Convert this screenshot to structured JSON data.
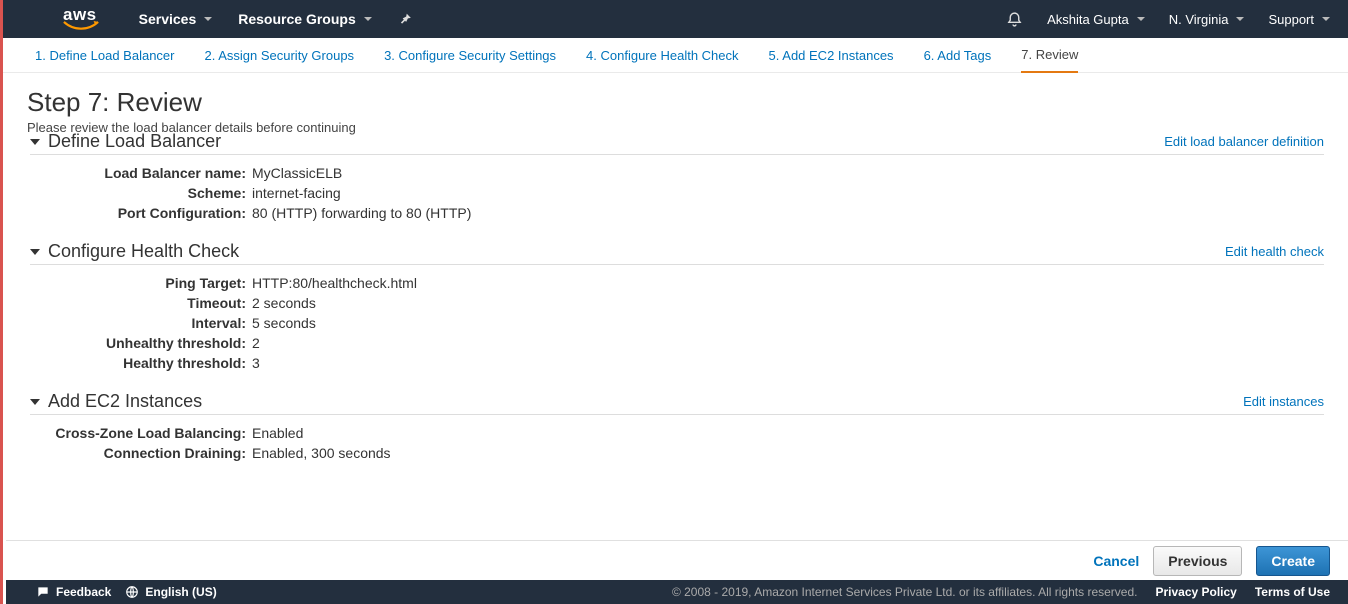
{
  "nav": {
    "logo_text": "aws",
    "services": "Services",
    "resource_groups": "Resource Groups",
    "user": "Akshita Gupta",
    "region": "N. Virginia",
    "support": "Support"
  },
  "wizard": {
    "steps": [
      "1. Define Load Balancer",
      "2. Assign Security Groups",
      "3. Configure Security Settings",
      "4. Configure Health Check",
      "5. Add EC2 Instances",
      "6. Add Tags",
      "7. Review"
    ],
    "active_index": 6
  },
  "page": {
    "title": "Step 7: Review",
    "subtitle": "Please review the load balancer details before continuing"
  },
  "sections": {
    "define": {
      "title": "Define Load Balancer",
      "edit": "Edit load balancer definition",
      "rows": {
        "lb_name_label": "Load Balancer name:",
        "lb_name_value": "MyClassicELB",
        "scheme_label": "Scheme:",
        "scheme_value": "internet-facing",
        "port_label": "Port Configuration:",
        "port_value": "80 (HTTP) forwarding to 80 (HTTP)"
      }
    },
    "health": {
      "title": "Configure Health Check",
      "edit": "Edit health check",
      "rows": {
        "ping_label": "Ping Target:",
        "ping_value": "HTTP:80/healthcheck.html",
        "timeout_label": "Timeout:",
        "timeout_value": "2 seconds",
        "interval_label": "Interval:",
        "interval_value": "5 seconds",
        "unhealthy_label": "Unhealthy threshold:",
        "unhealthy_value": "2",
        "healthy_label": "Healthy threshold:",
        "healthy_value": "3"
      }
    },
    "ec2": {
      "title": "Add EC2 Instances",
      "edit": "Edit instances",
      "rows": {
        "czlb_label": "Cross-Zone Load Balancing:",
        "czlb_value": "Enabled",
        "drain_label": "Connection Draining:",
        "drain_value": "Enabled, 300 seconds"
      }
    }
  },
  "actions": {
    "cancel": "Cancel",
    "previous": "Previous",
    "create": "Create"
  },
  "footer": {
    "feedback": "Feedback",
    "language": "English (US)",
    "copy": "© 2008 - 2019, Amazon Internet Services Private Ltd. or its affiliates. All rights reserved.",
    "privacy": "Privacy Policy",
    "terms": "Terms of Use"
  }
}
